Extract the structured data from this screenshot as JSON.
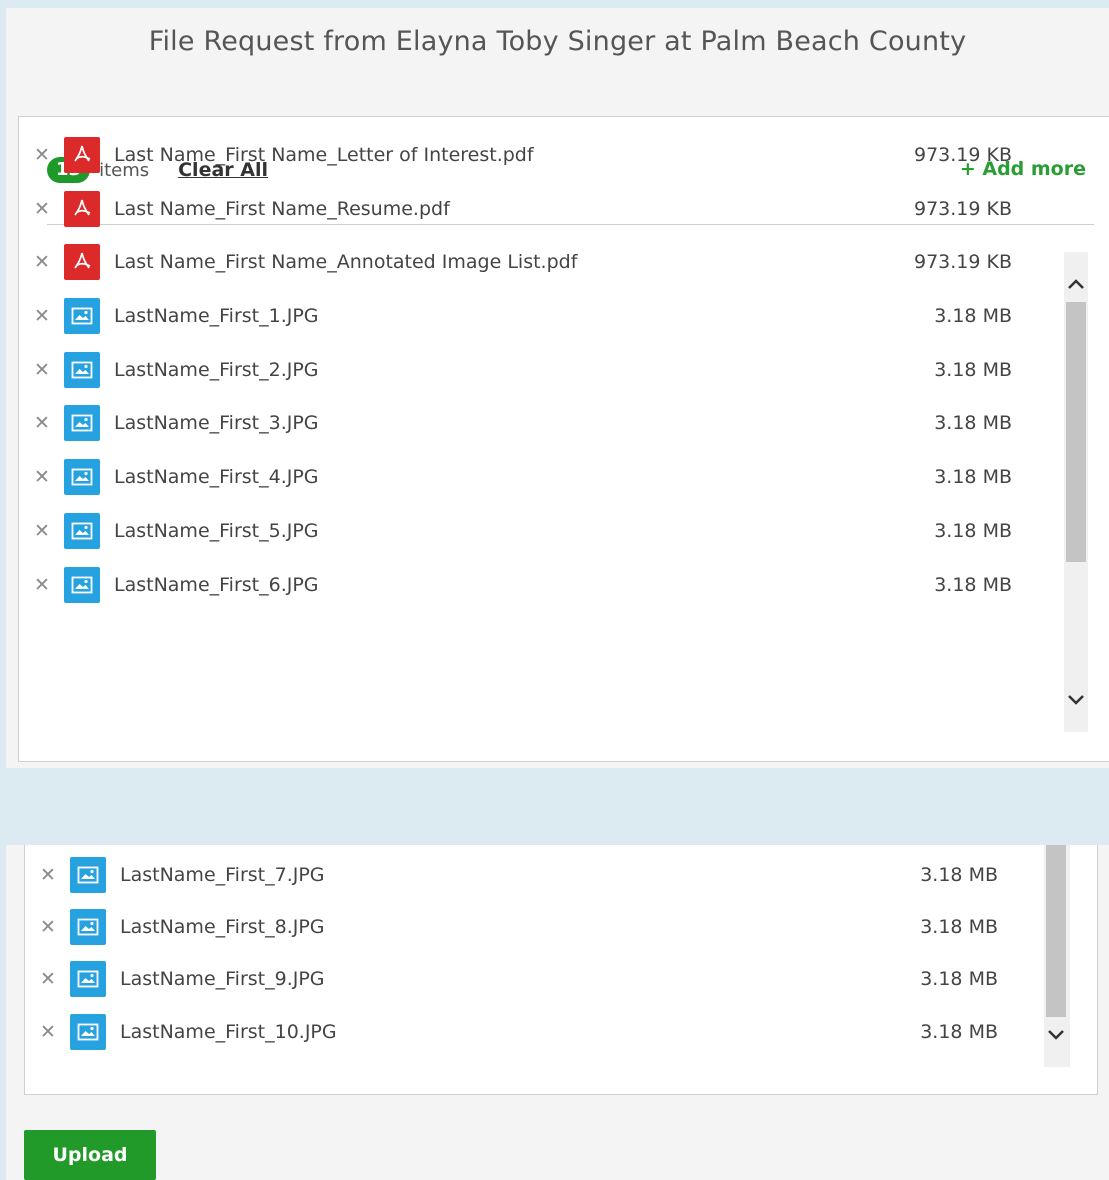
{
  "page_title": "File Request from Elayna Toby Singer at Palm Beach County",
  "summary": {
    "count": "13",
    "items_label": "items",
    "clear_all": "Clear All",
    "add_more": "+ Add more"
  },
  "files_top": [
    {
      "name": "Last Name_First Name_Letter of Interest.pdf",
      "size": "973.19 KB",
      "type": "pdf",
      "icon": "pdf-icon"
    },
    {
      "name": "Last Name_First Name_Resume.pdf",
      "size": "973.19 KB",
      "type": "pdf",
      "icon": "pdf-icon"
    },
    {
      "name": "Last Name_First Name_Annotated Image List.pdf",
      "size": "973.19 KB",
      "type": "pdf",
      "icon": "pdf-icon"
    },
    {
      "name": "LastName_First_1.JPG",
      "size": "3.18 MB",
      "type": "img",
      "icon": "image-icon"
    },
    {
      "name": "LastName_First_2.JPG",
      "size": "3.18 MB",
      "type": "img",
      "icon": "image-icon"
    },
    {
      "name": "LastName_First_3.JPG",
      "size": "3.18 MB",
      "type": "img",
      "icon": "image-icon"
    },
    {
      "name": "LastName_First_4.JPG",
      "size": "3.18 MB",
      "type": "img",
      "icon": "image-icon"
    },
    {
      "name": "LastName_First_5.JPG",
      "size": "3.18 MB",
      "type": "img",
      "icon": "image-icon"
    },
    {
      "name": "LastName_First_6.JPG",
      "size": "3.18 MB",
      "type": "img",
      "icon": "image-icon"
    }
  ],
  "files_bottom": [
    {
      "name": "LastName_First_7.JPG",
      "size": "3.18 MB",
      "type": "img",
      "icon": "image-icon"
    },
    {
      "name": "LastName_First_8.JPG",
      "size": "3.18 MB",
      "type": "img",
      "icon": "image-icon"
    },
    {
      "name": "LastName_First_9.JPG",
      "size": "3.18 MB",
      "type": "img",
      "icon": "image-icon"
    },
    {
      "name": "LastName_First_10.JPG",
      "size": "3.18 MB",
      "type": "img",
      "icon": "image-icon"
    }
  ],
  "upload_label": "Upload",
  "colors": {
    "accent_green": "#219a2a",
    "pdf_red": "#dc2a2a",
    "image_blue": "#27a2e0",
    "backdrop": "#dcebf1"
  }
}
